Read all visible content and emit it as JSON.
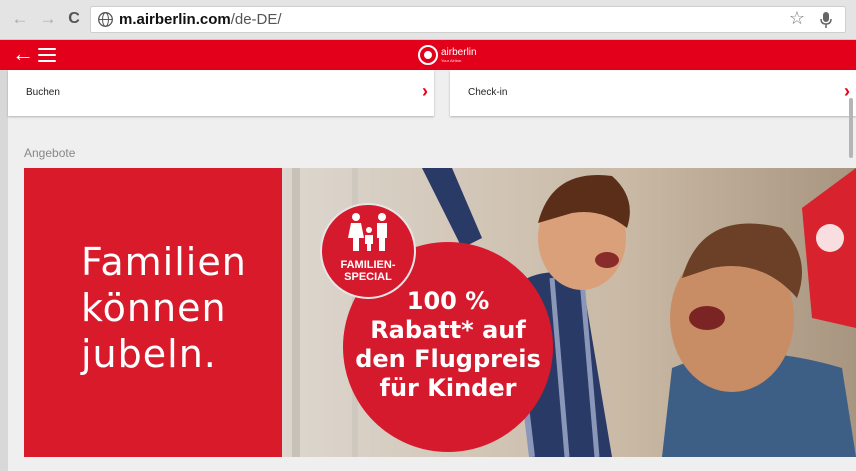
{
  "browser": {
    "back_icon": "arrow-left-icon",
    "forward_icon": "arrow-right-icon",
    "reload_icon": "reload-icon",
    "url_host": "m.airberlin.com",
    "url_path": "/de-DE/",
    "bookmark_icon": "star-icon",
    "voice_icon": "microphone-icon"
  },
  "appbar": {
    "color": "#e2001a",
    "back_icon": "arrow-left-icon",
    "menu_icon": "hamburger-icon",
    "logo_name": "airberlin",
    "logo_tagline": "Your Airline."
  },
  "cards": [
    {
      "label": "Buchen"
    },
    {
      "label": "Check-in"
    }
  ],
  "offers": {
    "section_title": "Angebote",
    "banner": {
      "headline_lines": [
        "Familien",
        "können",
        "jubeln."
      ],
      "badge_text": "FAMILIEN-\nSPECIAL",
      "offer_lines": [
        "100 %",
        "Rabatt* auf",
        "den Flugpreis",
        "für Kinder"
      ]
    }
  }
}
